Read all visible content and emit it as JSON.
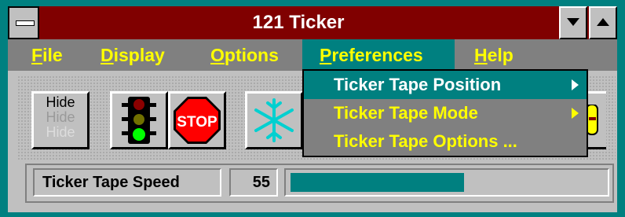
{
  "window": {
    "title": "121 Ticker"
  },
  "menu": {
    "file": {
      "u": "F",
      "rest": "ile"
    },
    "display": {
      "u": "D",
      "rest": "isplay"
    },
    "options": {
      "u": "O",
      "rest": "ptions"
    },
    "preferences": {
      "u": "P",
      "rest": "references"
    },
    "help": {
      "u": "H",
      "rest": "elp"
    }
  },
  "preferences_menu": {
    "items": [
      {
        "label": "Ticker Tape Position",
        "submenu": true
      },
      {
        "label": "Ticker Tape Mode",
        "submenu": true
      },
      {
        "label": "Ticker Tape Options ...",
        "submenu": false
      }
    ]
  },
  "toolbar": {
    "hide_lines": [
      "Hide",
      "Hide",
      "Hide"
    ],
    "stop_label": "STOP"
  },
  "speed": {
    "label": "Ticker Tape Speed",
    "value": "55",
    "fraction": 0.55
  },
  "colors": {
    "title_bar": "#800000",
    "accent": "#008080",
    "menu_text": "#ffff00",
    "menu_bg": "#808080"
  }
}
